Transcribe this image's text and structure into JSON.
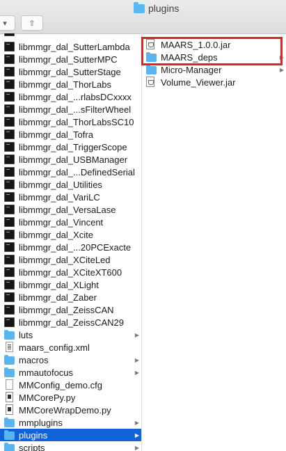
{
  "window": {
    "title": "plugins"
  },
  "toolbar": {
    "view_glyph": "▾",
    "share_glyph": "⇧"
  },
  "column1": {
    "items": [
      {
        "label": "libmmgr_dal_SutterLambda",
        "icon": "exec-icon"
      },
      {
        "label": "libmmgr_dal_SutterMPC",
        "icon": "exec-icon"
      },
      {
        "label": "libmmgr_dal_SutterStage",
        "icon": "exec-icon"
      },
      {
        "label": "libmmgr_dal_ThorLabs",
        "icon": "exec-icon"
      },
      {
        "label": "libmmgr_dal_...rlabsDCxxxx",
        "icon": "exec-icon"
      },
      {
        "label": "libmmgr_dal_...sFilterWheel",
        "icon": "exec-icon"
      },
      {
        "label": "libmmgr_dal_ThorLabsSC10",
        "icon": "exec-icon"
      },
      {
        "label": "libmmgr_dal_Tofra",
        "icon": "exec-icon"
      },
      {
        "label": "libmmgr_dal_TriggerScope",
        "icon": "exec-icon"
      },
      {
        "label": "libmmgr_dal_USBManager",
        "icon": "exec-icon"
      },
      {
        "label": "libmmgr_dal_...DefinedSerial",
        "icon": "exec-icon"
      },
      {
        "label": "libmmgr_dal_Utilities",
        "icon": "exec-icon"
      },
      {
        "label": "libmmgr_dal_VariLC",
        "icon": "exec-icon"
      },
      {
        "label": "libmmgr_dal_VersaLase",
        "icon": "exec-icon"
      },
      {
        "label": "libmmgr_dal_Vincent",
        "icon": "exec-icon"
      },
      {
        "label": "libmmgr_dal_Xcite",
        "icon": "exec-icon"
      },
      {
        "label": "libmmgr_dal_...20PCExacte",
        "icon": "exec-icon"
      },
      {
        "label": "libmmgr_dal_XCiteLed",
        "icon": "exec-icon"
      },
      {
        "label": "libmmgr_dal_XCiteXT600",
        "icon": "exec-icon"
      },
      {
        "label": "libmmgr_dal_XLight",
        "icon": "exec-icon"
      },
      {
        "label": "libmmgr_dal_Zaber",
        "icon": "exec-icon"
      },
      {
        "label": "libmmgr_dal_ZeissCAN",
        "icon": "exec-icon"
      },
      {
        "label": "libmmgr_dal_ZeissCAN29",
        "icon": "exec-icon"
      },
      {
        "label": "luts",
        "icon": "folder-icon",
        "arrow": "▶"
      },
      {
        "label": "maars_config.xml",
        "icon": "text-file-icon"
      },
      {
        "label": "macros",
        "icon": "folder-icon",
        "arrow": "▶"
      },
      {
        "label": "mmautofocus",
        "icon": "folder-icon",
        "arrow": "▶"
      },
      {
        "label": "MMConfig_demo.cfg",
        "icon": "document-icon"
      },
      {
        "label": "MMCorePy.py",
        "icon": "python-file-icon"
      },
      {
        "label": "MMCoreWrapDemo.py",
        "icon": "python-file-icon"
      },
      {
        "label": "mmplugins",
        "icon": "folder-icon",
        "arrow": "▶"
      },
      {
        "label": "plugins",
        "icon": "folder-icon",
        "arrow": "▶",
        "selected": true
      },
      {
        "label": "scripts",
        "icon": "folder-icon",
        "arrow": "▶"
      }
    ]
  },
  "column2": {
    "items": [
      {
        "label": "MAARS_1.0.0.jar",
        "icon": "jar-icon"
      },
      {
        "label": "MAARS_deps",
        "icon": "folder-icon",
        "arrow": "▶"
      },
      {
        "label": "Micro-Manager",
        "icon": "folder-icon",
        "arrow": "▶"
      },
      {
        "label": "Volume_Viewer.jar",
        "icon": "jar-icon"
      }
    ]
  },
  "colors": {
    "selection": "#1163d8",
    "highlight_box": "#e3221e",
    "folder": "#5ab4ee"
  }
}
